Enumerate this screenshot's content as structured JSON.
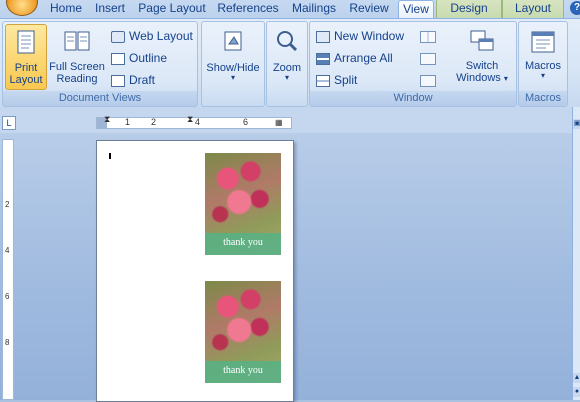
{
  "tabs": [
    {
      "label": "Home",
      "active": false
    },
    {
      "label": "Insert",
      "active": false
    },
    {
      "label": "Page Layout",
      "active": false
    },
    {
      "label": "References",
      "active": false
    },
    {
      "label": "Mailings",
      "active": false
    },
    {
      "label": "Review",
      "active": false
    },
    {
      "label": "View",
      "active": true
    },
    {
      "label": "Design",
      "active": false,
      "contextual": true
    },
    {
      "label": "Layout",
      "active": false,
      "contextual": true
    }
  ],
  "groups": {
    "document_views": {
      "label": "Document Views",
      "print_layout": "Print Layout",
      "print_layout_line1": "Print",
      "print_layout_line2": "Layout",
      "full_screen_line1": "Full Screen",
      "full_screen_line2": "Reading",
      "web_layout": "Web Layout",
      "outline": "Outline",
      "draft": "Draft"
    },
    "show_hide": {
      "label": "Show/Hide"
    },
    "zoom": {
      "label": "Zoom"
    },
    "window": {
      "label": "Window",
      "new_window": "New Window",
      "arrange_all": "Arrange All",
      "split": "Split",
      "switch_line1": "Switch",
      "switch_line2": "Windows"
    },
    "macros": {
      "label": "Macros",
      "button": "Macros"
    }
  },
  "ruler": {
    "h_numbers": [
      "1",
      "2",
      "4",
      "6"
    ],
    "v_numbers": [
      "2",
      "4",
      "6",
      "8"
    ]
  },
  "document": {
    "cards": [
      {
        "text": "thank you"
      },
      {
        "text": "thank you"
      }
    ]
  },
  "colors": {
    "accent": "#15428b",
    "selected_button": "#f9c84f",
    "card_band": "#56b287"
  }
}
